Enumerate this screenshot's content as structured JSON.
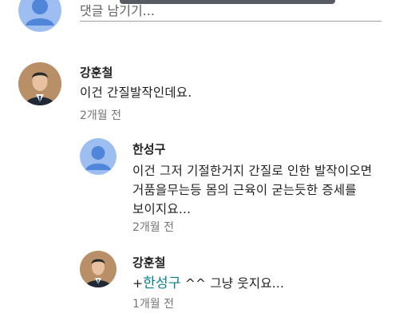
{
  "reply_box": {
    "placeholder": "댓글 남기기..."
  },
  "comments": [
    {
      "author": "강훈철",
      "text": "이건 간질발작인데요.",
      "time": "2개월 전"
    },
    {
      "author": "한성구",
      "lines": [
        "이건 그저 기절한거지 간질로 인한 발작이오면",
        "거품을무는등 몸의 근육이 굳는듯한 증세를",
        "보이지요..."
      ],
      "time": "2개월 전"
    },
    {
      "author": "강훈철",
      "prefix": "+",
      "mention": "한성구",
      "rest": " ^^ 그냥 웃지요...",
      "time": "1개월 전"
    }
  ],
  "colors": {
    "mention": "#0a7e8c",
    "default_avatar_bg": "#4f86d9",
    "default_avatar_fg": "#cfe0fb",
    "timestamp": "#757575"
  },
  "icons": {
    "default_avatar": "person-silhouette-icon",
    "profile_photo": "profile-photo-icon"
  }
}
